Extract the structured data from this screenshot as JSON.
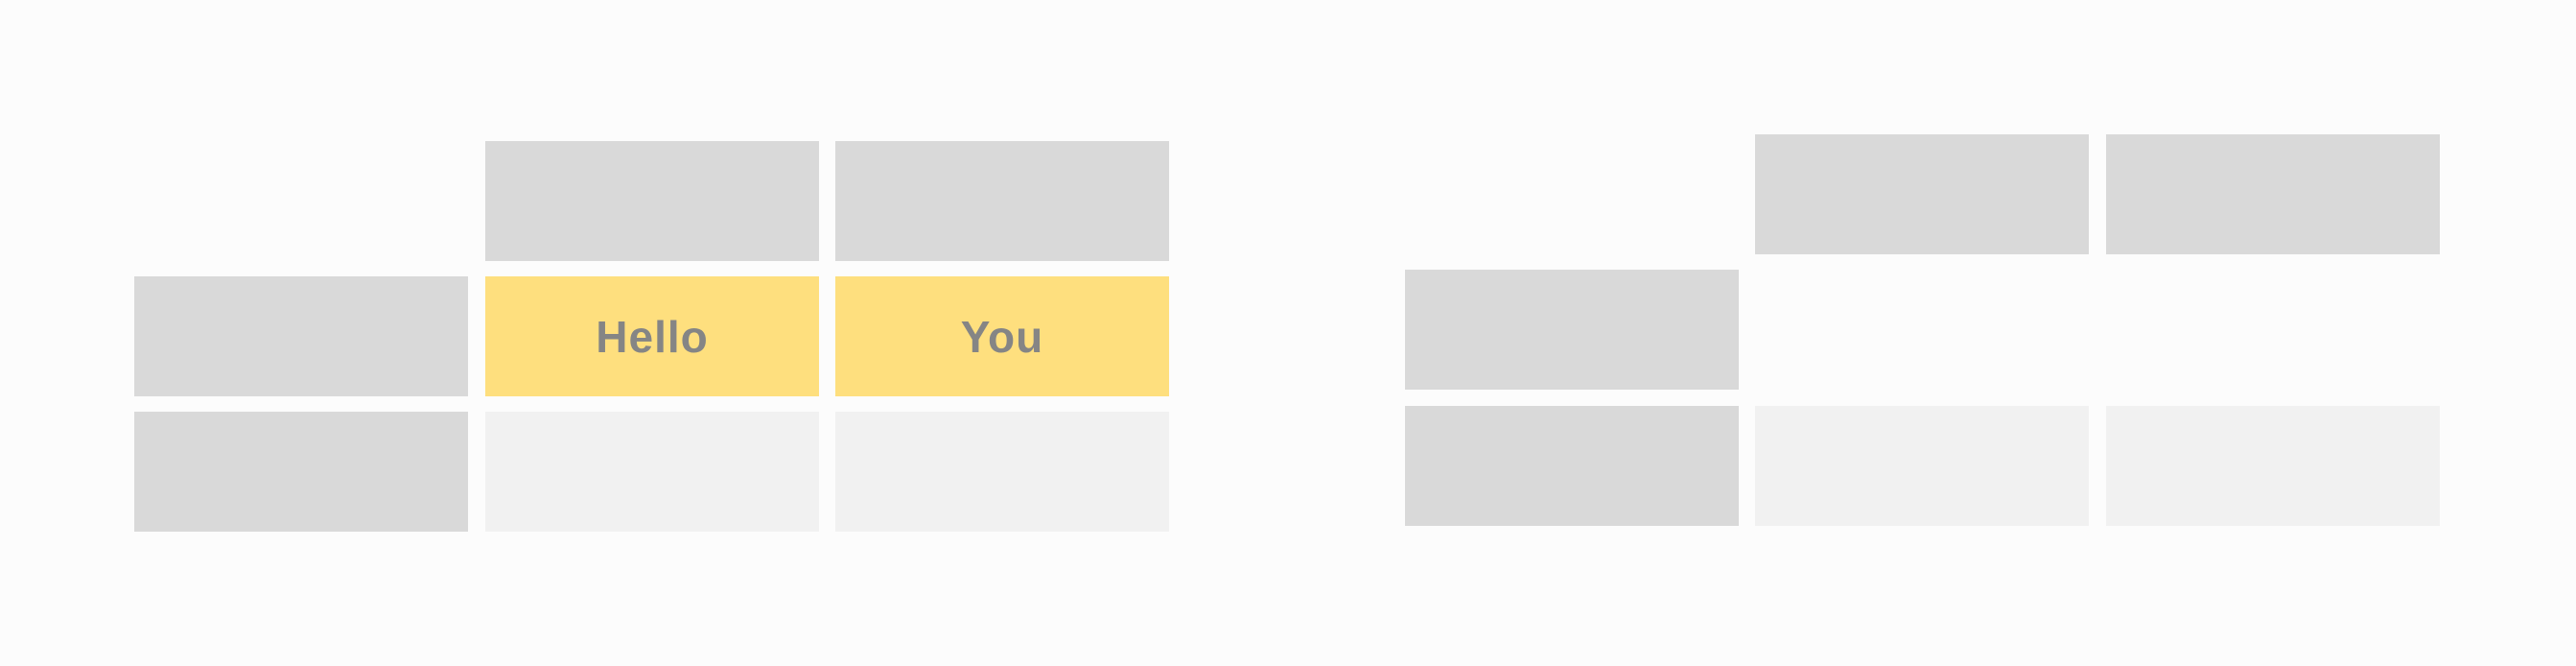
{
  "left_table": {
    "highlighted_cells": [
      "Hello",
      "You"
    ]
  },
  "colors": {
    "header": "#d9d9d9",
    "body": "#f1f1f1",
    "highlight": "#fedf7e",
    "text": "#858585",
    "background": "#fcfcfc"
  }
}
